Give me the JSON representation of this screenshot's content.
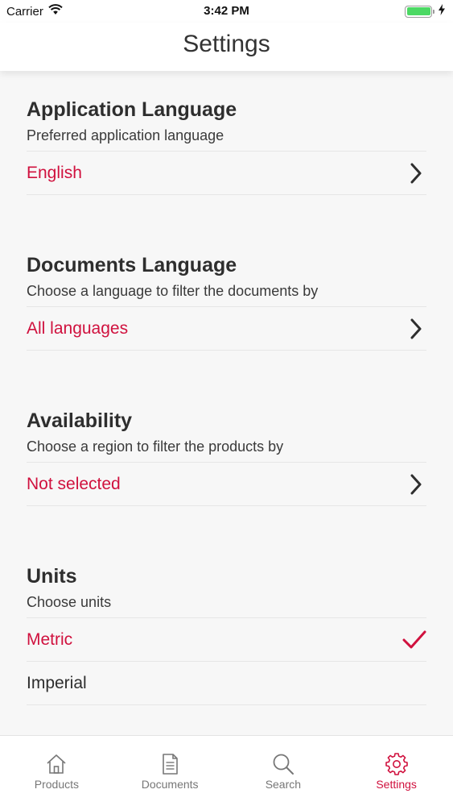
{
  "status_bar": {
    "carrier": "Carrier",
    "time": "3:42 PM",
    "battery_level": 1.0
  },
  "nav": {
    "title": "Settings"
  },
  "sections": [
    {
      "title": "Application Language",
      "subtitle": "Preferred application language",
      "value": "English"
    },
    {
      "title": "Documents Language",
      "subtitle": "Choose a language to filter the documents by",
      "value": "All languages"
    },
    {
      "title": "Availability",
      "subtitle": "Choose a region to filter the products by",
      "value": "Not selected"
    }
  ],
  "units": {
    "title": "Units",
    "subtitle": "Choose units",
    "options": [
      {
        "label": "Metric",
        "selected": true
      },
      {
        "label": "Imperial",
        "selected": false
      }
    ]
  },
  "tabs": [
    {
      "label": "Products",
      "icon": "house-icon",
      "active": false
    },
    {
      "label": "Documents",
      "icon": "document-icon",
      "active": false
    },
    {
      "label": "Search",
      "icon": "search-icon",
      "active": false
    },
    {
      "label": "Settings",
      "icon": "gear-icon",
      "active": true
    }
  ],
  "colors": {
    "accent": "#d0113e",
    "text": "#2e2e2e",
    "background": "#f7f7f7",
    "tab_inactive": "#777777",
    "battery": "#4cd964"
  }
}
